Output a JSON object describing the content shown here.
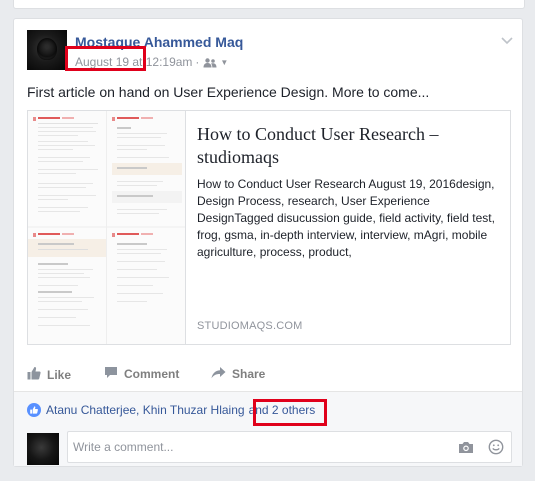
{
  "post": {
    "author": "Mostaque Ahammed Maq",
    "timestamp": "August 19 at 12:19am",
    "separator": "·",
    "privacy_icon": "friends-icon",
    "text": "First article on hand on User Experience Design. More to come..."
  },
  "link_preview": {
    "title": "How to Conduct User Research – studiomaqs",
    "description": "How to Conduct User Research August 19, 2016design, Design Process, research, User Experience DesignTagged disucussion guide, field activity, field test, frog, gsma, in-depth interview, interview, mAgri, mobile agriculture, process, product,",
    "domain": "STUDIOMAQS.COM"
  },
  "actions": {
    "like": "Like",
    "comment": "Comment",
    "share": "Share"
  },
  "likes": {
    "text_names": "Atanu Chatterjee, Khin Thuzar Hlaing",
    "text_others": "and 2 others"
  },
  "comment_box": {
    "placeholder": "Write a comment..."
  },
  "colors": {
    "link_blue": "#365899",
    "highlight_red": "#e0001b",
    "like_blue": "#5890ff"
  }
}
